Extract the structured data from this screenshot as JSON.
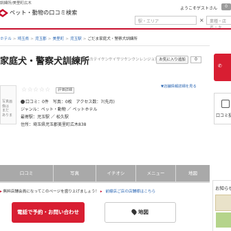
{
  "header": {
    "breadcrumb_top": "訓練所/美里町広木",
    "site_title": "ペット・動物の口コミ検索",
    "welcome": "ようこそゲストさん",
    "welcome_count": "0",
    "area_placeholder": "駅・エリア",
    "search_sep": "×",
    "keyword_placeholder": "業種・店名・キ"
  },
  "breadcrumb": [
    "ホテル",
    "埼玉県",
    "児玉郡",
    "美里町",
    "児玉駅",
    "ごだま家庭犬・警察犬訓練所"
  ],
  "shop": {
    "name": "家庭犬・警察犬訓練所",
    "kana": "（ゴダマカテイケンケイサツケンクンレンジョ）",
    "fav_label": "お気に入り追加",
    "fav_count": "0",
    "info_link": "▼店舗情報詳細を見る",
    "stars": "☆☆☆☆☆",
    "eval_tag": "評価詳細",
    "photo_text": "写真画\n像は\nまだ\nありま",
    "stats": "口コミ：0件　写真：0枚　アクセス数：7(先月)",
    "genre": "ジャンル：ペット・動物 ／ ペットホテル",
    "station": "最寄駅：児玉駅 ／ 松久駅",
    "address": "住所：埼玉県児玉郡美里町広木838"
  },
  "right": {
    "review_label": "口コミ投",
    "oshirase_title": "お知らせ"
  },
  "tabs": [
    "口コミ",
    "写真",
    "イチオシ",
    "メニュー",
    "地図"
  ],
  "notice": {
    "text": "無料店舗会員になってこのページを盛り上げましょう！",
    "link": "前線店ご店の店舗様はこちら"
  },
  "buttons": {
    "reserve": "電話で予約・お問い合わせ",
    "map": "地図"
  },
  "colors": {
    "brand_red": "#c8102e",
    "button_red": "#d81e32",
    "tab_gray": "#a9a9a9",
    "link_blue": "#2a66b3"
  }
}
